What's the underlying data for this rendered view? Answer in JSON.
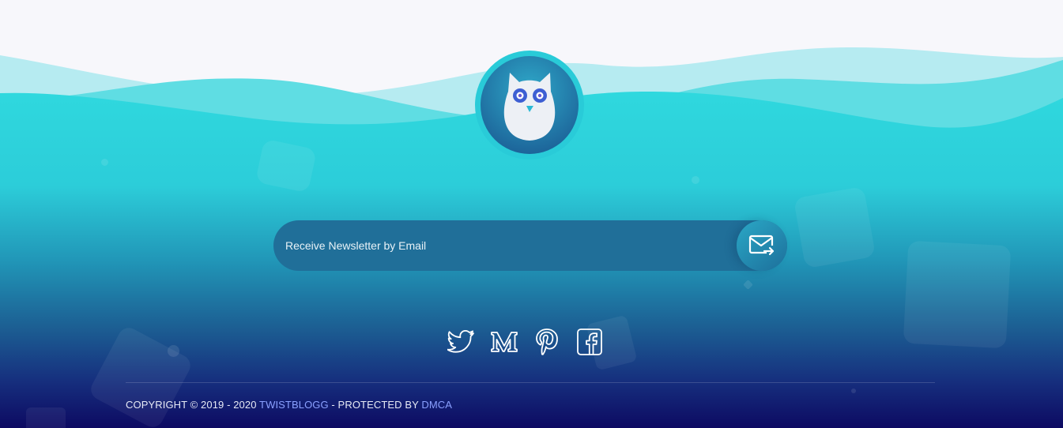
{
  "colors": {
    "page_bg": "#f7f7fb",
    "wave_light": "#b4eaf0",
    "wave_mid": "#6cdbe3",
    "teal_top": "#2dd5dc",
    "blue_mid": "#1e6a98",
    "navy_bottom": "#0e0c64",
    "link_accent": "#8aa0ff"
  },
  "logo": {
    "icon": "owl-icon"
  },
  "newsletter": {
    "placeholder": "Receive Newsletter by Email",
    "value": "",
    "submit_icon": "mail-send-icon"
  },
  "social": [
    {
      "icon": "twitter-icon"
    },
    {
      "icon": "medium-icon"
    },
    {
      "icon": "pinterest-icon"
    },
    {
      "icon": "facebook-icon"
    }
  ],
  "copyright": {
    "prefix": "COPYRIGHT © 2019 - 2020 ",
    "brand": "TWISTBLOGG",
    "middle": " - PROTECTED BY ",
    "dmca": "DMCA"
  }
}
